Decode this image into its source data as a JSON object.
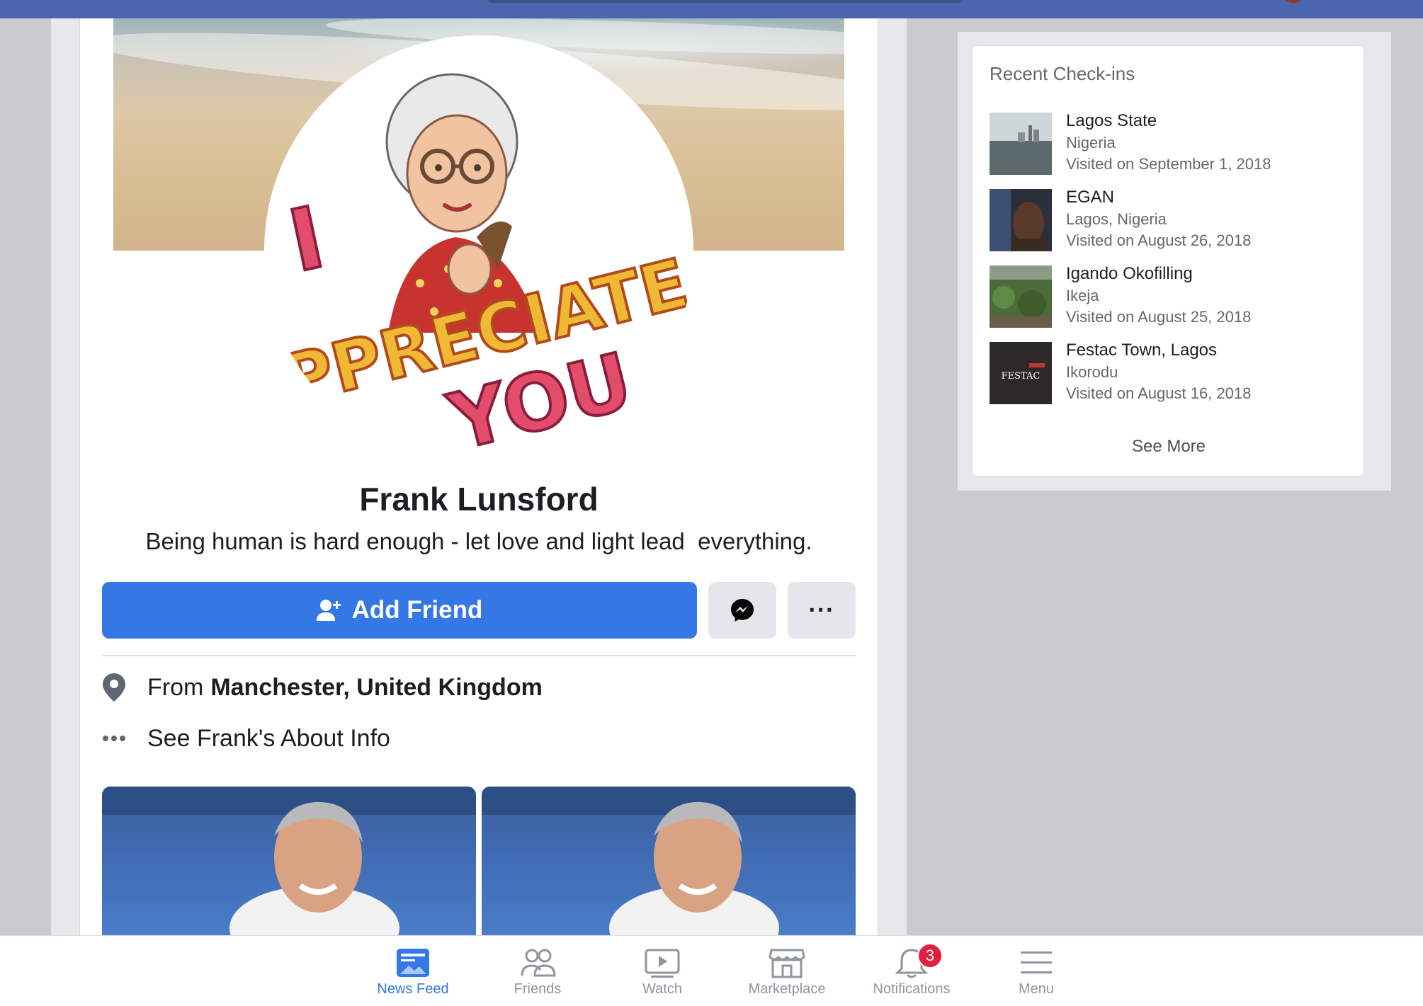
{
  "profile": {
    "name": "Frank Lunsford",
    "bio": "Being human is hard enough - let love and light lead  everything.",
    "avatar_text_line1": "I",
    "avatar_text_line2": "PPRECIATE",
    "avatar_text_line3": "YOU"
  },
  "actions": {
    "add_friend_label": "Add Friend",
    "more_label": "···"
  },
  "info": {
    "from_prefix": "From",
    "from_place": "Manchester, United Kingdom",
    "about_link": "See Frank's About Info"
  },
  "checkins": {
    "title": "Recent Check-ins",
    "items": [
      {
        "place": "Lagos State",
        "location": "Nigeria",
        "visited": "Visited on September 1, 2018"
      },
      {
        "place": "EGAN",
        "location": "Lagos, Nigeria",
        "visited": "Visited on August 26, 2018"
      },
      {
        "place": "Igando Okofilling",
        "location": "Ikeja",
        "visited": "Visited on August 25, 2018"
      },
      {
        "place": "Festac Town, Lagos",
        "location": "Ikorodu",
        "visited": "Visited on August 16, 2018"
      }
    ],
    "festac_thumb_text": "FESTAC",
    "see_more": "See More"
  },
  "bottom_nav": {
    "items": [
      {
        "label": "News Feed",
        "icon": "news-feed-icon",
        "active": true
      },
      {
        "label": "Friends",
        "icon": "friends-icon",
        "active": false
      },
      {
        "label": "Watch",
        "icon": "watch-icon",
        "active": false
      },
      {
        "label": "Marketplace",
        "icon": "marketplace-icon",
        "active": false
      },
      {
        "label": "Notifications",
        "icon": "bell-icon",
        "active": false,
        "badge": "3"
      },
      {
        "label": "Menu",
        "icon": "menu-icon",
        "active": false
      }
    ]
  },
  "colors": {
    "brand_blue": "#3578e5",
    "top_bar": "#4a67ad",
    "badge_red": "#e41e3f"
  }
}
